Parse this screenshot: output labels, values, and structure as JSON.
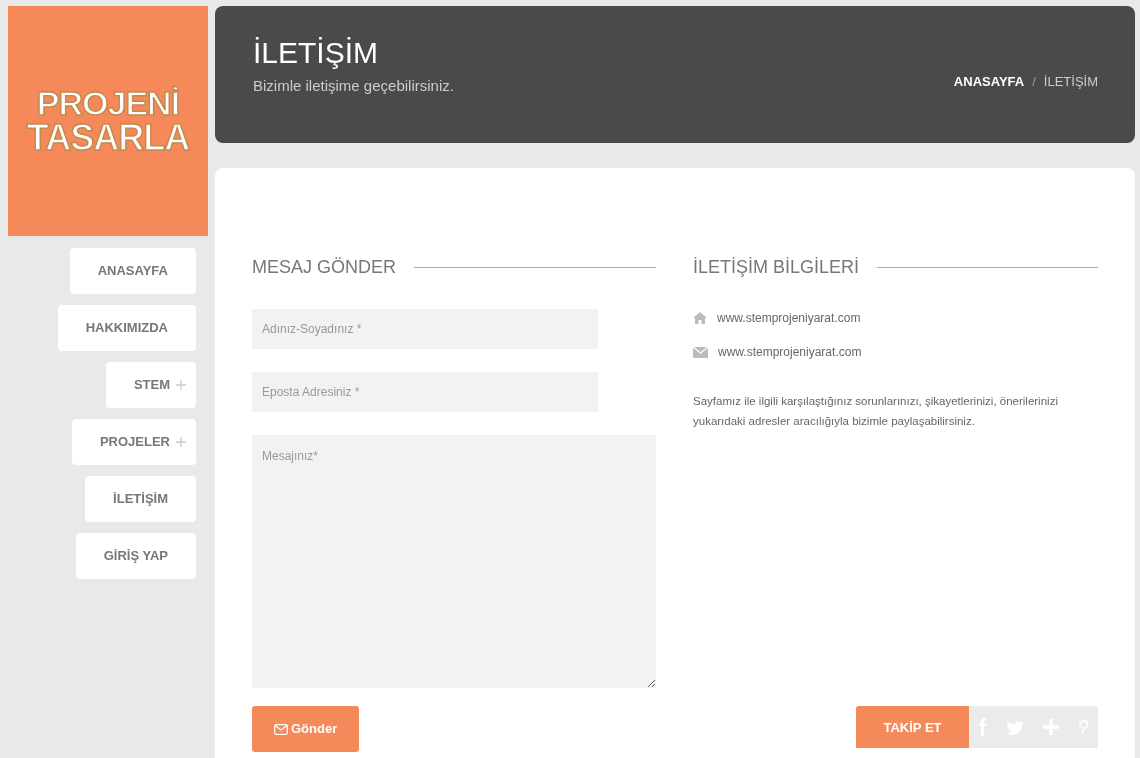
{
  "logo": {
    "lines": [
      "PROJENİ",
      "TASARLA"
    ]
  },
  "sidebar": {
    "items": [
      {
        "label": "ANASAYFA",
        "expandable": false
      },
      {
        "label": "HAKKIMIZDA",
        "expandable": false
      },
      {
        "label": "STEM",
        "expandable": true
      },
      {
        "label": "PROJELER",
        "expandable": true
      },
      {
        "label": "İLETİŞİM",
        "expandable": false
      },
      {
        "label": "GİRİŞ YAP",
        "expandable": false
      }
    ]
  },
  "header": {
    "title": "İLETİŞİM",
    "subtitle": "Bizimle iletişime geçebilirsiniz.",
    "breadcrumb": [
      {
        "label": "ANASAYFA",
        "selected": false
      },
      {
        "label": "İLETİŞİM",
        "selected": true
      }
    ],
    "separator": "/"
  },
  "form": {
    "heading": "MESAJ GÖNDER",
    "fields": [
      {
        "kind": "input",
        "placeholder": "Adınız-Soyadınız *"
      },
      {
        "kind": "input",
        "placeholder": "Eposta Adresiniz *"
      },
      {
        "kind": "textarea",
        "placeholder": "Mesajınız*"
      }
    ],
    "submit": "Gönder"
  },
  "contact": {
    "heading": "İLETİŞİM BİLGİLERİ",
    "items": [
      {
        "kind": "home",
        "text": "www.stemprojeniyarat.com"
      },
      {
        "kind": "mail",
        "text": "www.stemprojeniyarat.com"
      }
    ],
    "note": "Sayfamız ile ilgili karşılaştığınız sorunlarınızı, şikayetlerinizi, önerilerinizi yukarıdaki adresler aracılığıyla bizimle paylaşabilirsiniz."
  },
  "social": {
    "label": "TAKİP ET",
    "links": [
      {
        "kind": "facebook"
      },
      {
        "kind": "twitter"
      },
      {
        "kind": "plus"
      },
      {
        "kind": "pinterest"
      }
    ]
  }
}
